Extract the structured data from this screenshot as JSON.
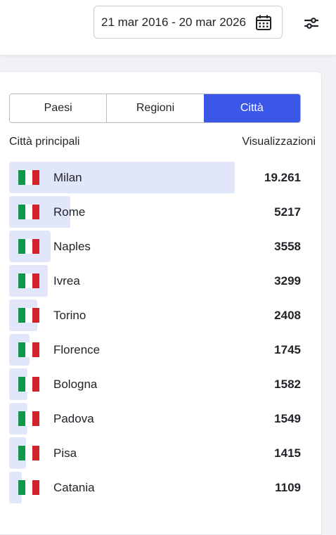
{
  "header": {
    "date_range": "21 mar 2016 - 20 mar 2026",
    "calendar_icon": "calendar-icon",
    "filter_icon": "sliders-icon"
  },
  "tabs": [
    {
      "label": "Paesi",
      "active": false
    },
    {
      "label": "Regioni",
      "active": false
    },
    {
      "label": "Città",
      "active": true
    }
  ],
  "table": {
    "col_left": "Città principali",
    "col_right": "Visualizzazioni",
    "rows": [
      {
        "flag": "it-flag-icon",
        "name": "Milan",
        "value": "19.261",
        "views": 19261
      },
      {
        "flag": "it-flag-icon",
        "name": "Rome",
        "value": "5217",
        "views": 5217
      },
      {
        "flag": "it-flag-icon",
        "name": "Naples",
        "value": "3558",
        "views": 3558
      },
      {
        "flag": "it-flag-icon",
        "name": "Ivrea",
        "value": "3299",
        "views": 3299
      },
      {
        "flag": "it-flag-icon",
        "name": "Torino",
        "value": "2408",
        "views": 2408
      },
      {
        "flag": "it-flag-icon",
        "name": "Florence",
        "value": "1745",
        "views": 1745
      },
      {
        "flag": "it-flag-icon",
        "name": "Bologna",
        "value": "1582",
        "views": 1582
      },
      {
        "flag": "it-flag-icon",
        "name": "Padova",
        "value": "1549",
        "views": 1549
      },
      {
        "flag": "it-flag-icon",
        "name": "Pisa",
        "value": "1415",
        "views": 1415
      },
      {
        "flag": "it-flag-icon",
        "name": "Catania",
        "value": "1109",
        "views": 1109
      }
    ]
  },
  "colors": {
    "accent": "#3b57e8",
    "bar": "#e2e6fb"
  }
}
